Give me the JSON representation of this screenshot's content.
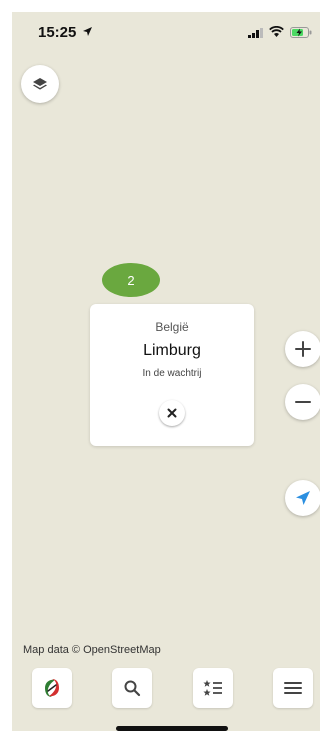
{
  "status_bar": {
    "time": "15:25",
    "icons": [
      "location-arrow-icon",
      "signal-icon",
      "wifi-icon",
      "battery-charging-icon"
    ]
  },
  "map": {
    "background_color": "#e9e7d9",
    "layers_button_icon": "layers-icon",
    "cluster": {
      "count": "2",
      "color": "#6aa83f"
    },
    "attribution": "Map data © OpenStreetMap"
  },
  "info_card": {
    "country": "België",
    "region": "Limburg",
    "status": "In de wachtrij",
    "close_icon": "close-icon"
  },
  "controls": {
    "zoom_in_icon": "plus-icon",
    "zoom_out_icon": "minus-icon",
    "locate_icon": "navigation-arrow-icon",
    "accent_color": "#2b8fe0"
  },
  "tab_bar": {
    "items": [
      {
        "name": "logo",
        "icon": "app-logo-icon"
      },
      {
        "name": "search",
        "icon": "search-icon"
      },
      {
        "name": "list",
        "icon": "rated-list-icon"
      },
      {
        "name": "menu",
        "icon": "hamburger-menu-icon"
      }
    ]
  }
}
